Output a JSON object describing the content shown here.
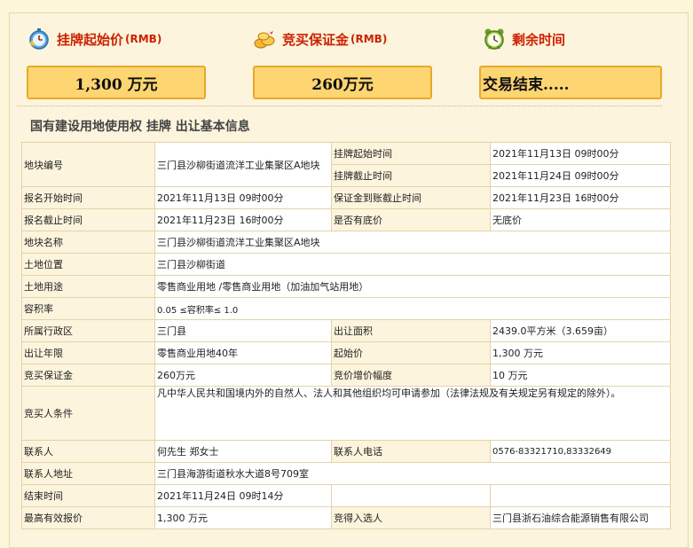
{
  "summary": {
    "start_price": {
      "label": "挂牌起始价",
      "unit": "(RMB)",
      "value": "1,300 万元",
      "icon": "stopwatch-icon"
    },
    "deposit": {
      "label": "竞买保证金",
      "unit": "(RMB)",
      "value": "260万元",
      "icon": "gold-coins-icon"
    },
    "remaining": {
      "label": "剩余时间",
      "value": "交易结束.....",
      "icon": "alarm-clock-icon"
    }
  },
  "section_title": "国有建设用地使用权 挂牌 出让基本信息",
  "table": {
    "parcel_no_label": "地块编号",
    "parcel_no": "三门县沙柳街道流洋工业集聚区A地块",
    "listing_start_label": "挂牌起始时间",
    "listing_start": "2021年11月13日 09时00分",
    "listing_end_label": "挂牌截止时间",
    "listing_end": "2021年11月24日 09时00分",
    "reg_start_label": "报名开始时间",
    "reg_start": "2021年11月13日 09时00分",
    "deposit_deadline_label": "保证金到账截止时间",
    "deposit_deadline": "2021年11月23日 16时00分",
    "reg_end_label": "报名截止时间",
    "reg_end": "2021年11月23日 16时00分",
    "reserve_label": "是否有底价",
    "reserve": "无底价",
    "parcel_name_label": "地块名称",
    "parcel_name": "三门县沙柳街道流洋工业集聚区A地块",
    "location_label": "土地位置",
    "location": "三门县沙柳街道",
    "use_label": "土地用途",
    "use": "零售商业用地 /零售商业用地（加油加气站用地）",
    "far_label": "容积率",
    "far": "0.05 ≤容积率≤ 1.0",
    "district_label": "所属行政区",
    "district": "三门县",
    "area_label": "出让面积",
    "area": "2439.0平方米（3.659亩）",
    "term_label": "出让年限",
    "term": "零售商业用地40年",
    "start_price_label": "起始价",
    "start_price": "1,300 万元",
    "bid_deposit_label": "竞买保证金",
    "bid_deposit": "260万元",
    "increment_label": "竞价增价幅度",
    "increment": "10 万元",
    "conditions_label": "竞买人条件",
    "conditions": "凡中华人民共和国境内外的自然人、法人和其他组织均可申请参加（法律法规及有关规定另有规定的除外）。",
    "contact_label": "联系人",
    "contact": "何先生 郑女士",
    "phone_label": "联系人电话",
    "phone": "0576-83321710,83332649",
    "address_label": "联系人地址",
    "address": "三门县海游街道秋水大道8号709室",
    "end_time_label": "结束时间",
    "end_time": "2021年11月24日 09时14分",
    "top_bid_label": "最高有效报价",
    "top_bid": "1,300 万元",
    "winner_label": "竞得入选人",
    "winner": "三门县浙石油综合能源销售有限公司"
  }
}
